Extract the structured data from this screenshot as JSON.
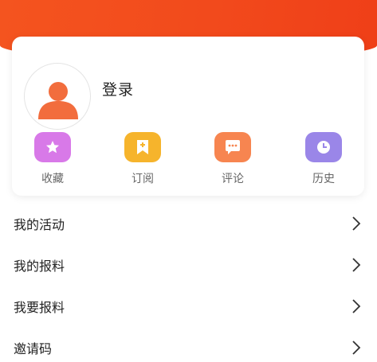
{
  "profile": {
    "login_label": "登录"
  },
  "quick_actions": [
    {
      "label": "收藏",
      "icon": "star-icon",
      "color": "#d879e8"
    },
    {
      "label": "订阅",
      "icon": "bookmark-icon",
      "color": "#f6b42c"
    },
    {
      "label": "评论",
      "icon": "chat-bubble-icon",
      "color": "#f78550"
    },
    {
      "label": "历史",
      "icon": "clock-icon",
      "color": "#9a86e8"
    }
  ],
  "menu": [
    {
      "label": "我的活动"
    },
    {
      "label": "我的报料"
    },
    {
      "label": "我要报料"
    },
    {
      "label": "邀请码"
    }
  ],
  "colors": {
    "header": "#f24a1c",
    "avatar_accent": "#f26d3d"
  }
}
